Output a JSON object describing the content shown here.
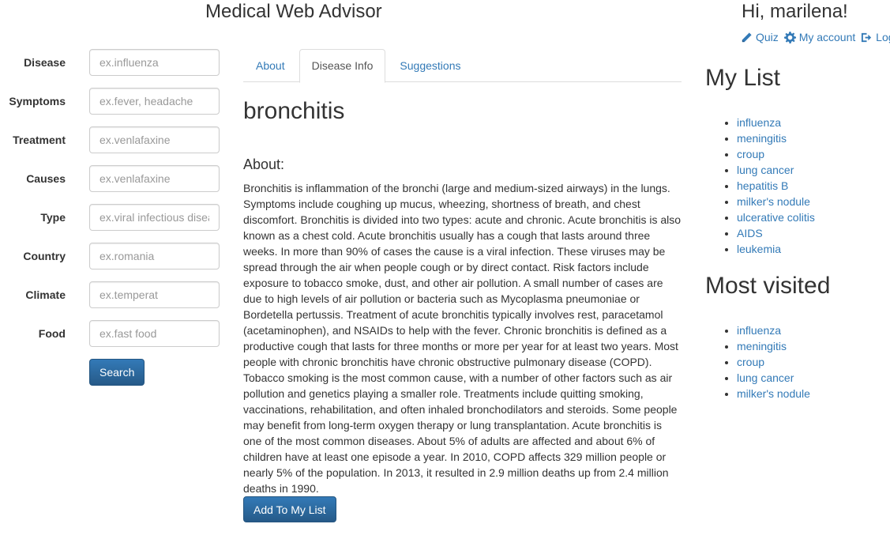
{
  "header": {
    "site_title": "Medical Web Advisor",
    "greeting": "Hi, marilena!",
    "links": [
      {
        "label": "Quiz",
        "icon": "pencil-icon"
      },
      {
        "label": "My account",
        "icon": "gear-icon"
      },
      {
        "label": "Logout",
        "icon": "logout-icon"
      }
    ]
  },
  "search": {
    "fields": [
      {
        "label": "Disease",
        "placeholder": "ex.influenza"
      },
      {
        "label": "Symptoms",
        "placeholder": "ex.fever, headache"
      },
      {
        "label": "Treatment",
        "placeholder": "ex.venlafaxine"
      },
      {
        "label": "Causes",
        "placeholder": "ex.venlafaxine"
      },
      {
        "label": "Type",
        "placeholder": "ex.viral infectious disease"
      },
      {
        "label": "Country",
        "placeholder": "ex.romania"
      },
      {
        "label": "Climate",
        "placeholder": "ex.temperat"
      },
      {
        "label": "Food",
        "placeholder": "ex.fast food"
      }
    ],
    "button_label": "Search"
  },
  "tabs": [
    {
      "label": "About",
      "active": false
    },
    {
      "label": "Disease Info",
      "active": true
    },
    {
      "label": "Suggestions",
      "active": false
    }
  ],
  "main": {
    "disease_name": "bronchitis",
    "about_heading": "About:",
    "about_text": "Bronchitis is inflammation of the bronchi (large and medium-sized airways) in the lungs. Symptoms include coughing up mucus, wheezing, shortness of breath, and chest discomfort. Bronchitis is divided into two types: acute and chronic. Acute bronchitis is also known as a chest cold. Acute bronchitis usually has a cough that lasts around three weeks. In more than 90% of cases the cause is a viral infection. These viruses may be spread through the air when people cough or by direct contact. Risk factors include exposure to tobacco smoke, dust, and other air pollution. A small number of cases are due to high levels of air pollution or bacteria such as Mycoplasma pneumoniae or Bordetella pertussis. Treatment of acute bronchitis typically involves rest, paracetamol (acetaminophen), and NSAIDs to help with the fever. Chronic bronchitis is defined as a productive cough that lasts for three months or more per year for at least two years. Most people with chronic bronchitis have chronic obstructive pulmonary disease (COPD). Tobacco smoking is the most common cause, with a number of other factors such as air pollution and genetics playing a smaller role. Treatments include quitting smoking, vaccinations, rehabilitation, and often inhaled bronchodilators and steroids. Some people may benefit from long-term oxygen therapy or lung transplantation. Acute bronchitis is one of the most common diseases. About 5% of adults are affected and about 6% of children have at least one episode a year. In 2010, COPD affects 329 million people or nearly 5% of the population. In 2013, it resulted in 2.9 million deaths up from 2.4 million deaths in 1990.",
    "add_button_label": "Add To My List"
  },
  "sidebar": {
    "my_list_heading": "My List",
    "my_list": [
      "influenza",
      "meningitis",
      "croup",
      "lung cancer",
      "hepatitis B",
      "milker's nodule",
      "ulcerative colitis",
      "AIDS",
      "leukemia"
    ],
    "most_visited_heading": "Most visited",
    "most_visited": [
      "influenza",
      "meningitis",
      "croup",
      "lung cancer",
      "milker's nodule"
    ]
  },
  "colors": {
    "link": "#337ab7",
    "primary_button": "#337ab7",
    "text": "#333333",
    "border": "#dddddd"
  }
}
